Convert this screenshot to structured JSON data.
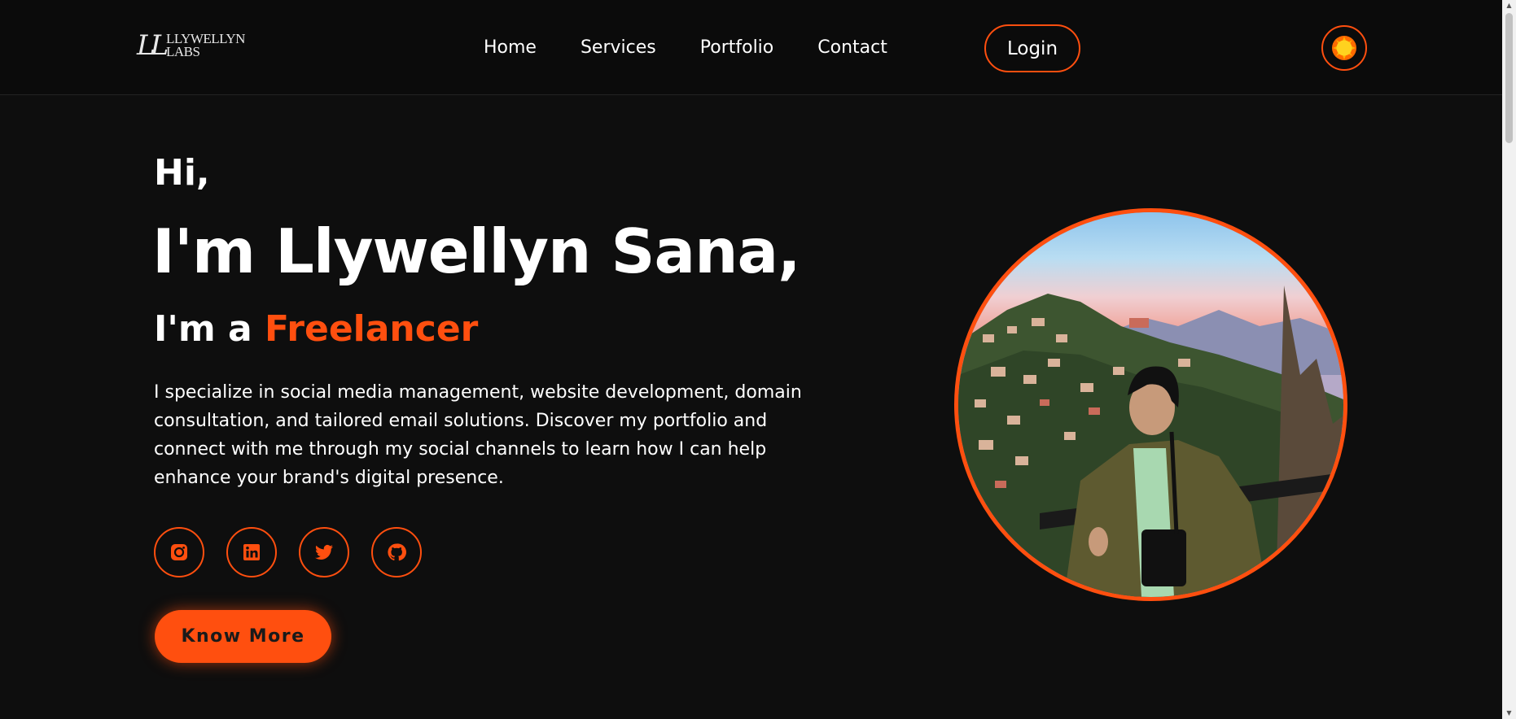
{
  "brand": {
    "logo_mark": "LL",
    "logo_line1": "LLYWELLYN",
    "logo_line2": "LABS"
  },
  "nav": {
    "items": [
      {
        "label": "Home"
      },
      {
        "label": "Services"
      },
      {
        "label": "Portfolio"
      },
      {
        "label": "Contact"
      }
    ],
    "login_label": "Login",
    "theme_icon": "sun-icon"
  },
  "hero": {
    "greeting": "Hi,",
    "name": "I'm Llywellyn Sana,",
    "role_prefix": "I'm a ",
    "role_highlight": "Freelancer",
    "description": "I specialize in social media management, website development, domain consultation, and tailored email solutions. Discover my portfolio and connect with me through my social channels to learn how I can help enhance your brand's digital presence.",
    "socials": [
      {
        "icon": "instagram-icon"
      },
      {
        "icon": "linkedin-icon"
      },
      {
        "icon": "twitter-icon"
      },
      {
        "icon": "github-icon"
      }
    ],
    "cta_label": "Know More",
    "portrait_icon": "profile-photo"
  },
  "colors": {
    "accent": "#ff4f0f",
    "background": "#0e0e0e",
    "navbar": "#0b0b0b",
    "text": "#ffffff"
  }
}
